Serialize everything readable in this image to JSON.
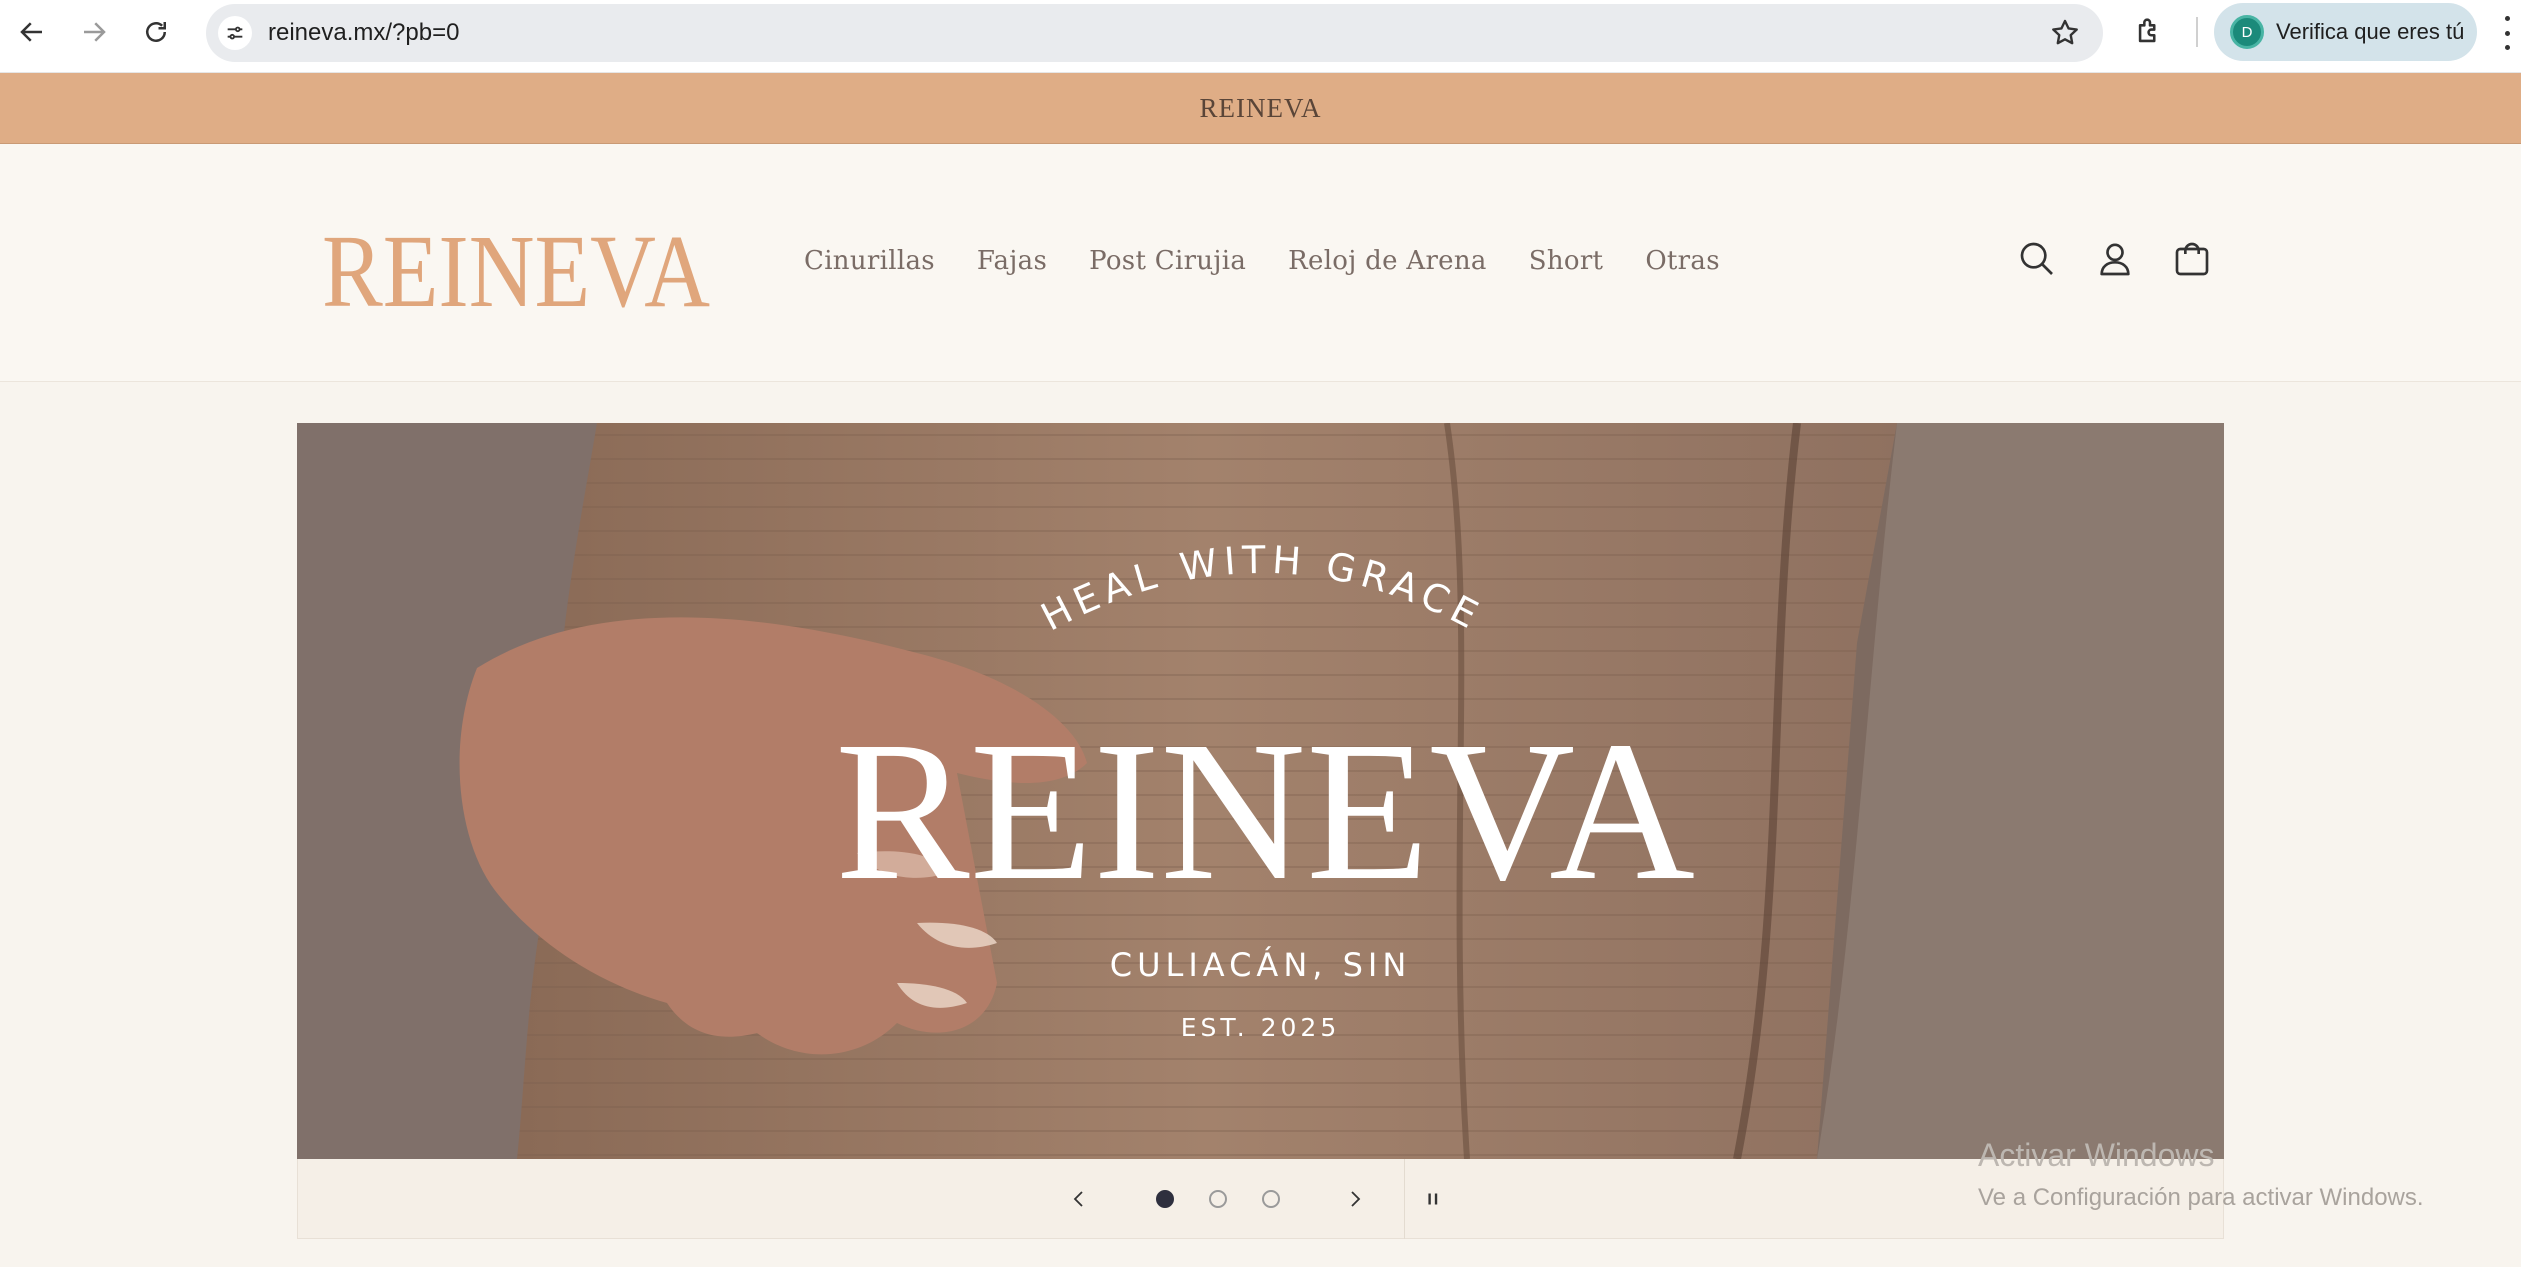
{
  "browser": {
    "url": "reineva.mx/?pb=0",
    "profile_initial": "D",
    "profile_label": "Verifica que eres tú",
    "icons": [
      "back-arrow-icon",
      "forward-arrow-icon",
      "reload-icon",
      "site-settings-icon",
      "bookmark-star-icon",
      "extensions-icon",
      "menu-dots-icon"
    ]
  },
  "announcement": {
    "text": "REINEVA"
  },
  "header": {
    "logo_text": "REINEVA",
    "nav": [
      "Cinurillas",
      "Fajas",
      "Post Cirujia",
      "Reloj de Arena",
      "Short",
      "Otras"
    ],
    "icons": [
      "search-icon",
      "account-icon",
      "cart-icon"
    ]
  },
  "slideshow": {
    "tagline": "HEAL WITH GRACE",
    "brand": "REINEVA",
    "location": "CULIACÁN, SIN",
    "established": "EST. 2025",
    "slide_count": 3,
    "active_slide": 1,
    "controls": [
      "previous-slide-icon",
      "next-slide-icon",
      "pause-icon"
    ]
  },
  "watermark": {
    "title": "Activar Windows",
    "subtitle": "Ve a Configuración para activar Windows."
  },
  "colors": {
    "announcement_bg": "#dfad86",
    "logo": "#e0a67c",
    "nav_text": "#7a6c66",
    "header_bg": "#faf7f2",
    "active_dot": "#2e2f3e"
  }
}
